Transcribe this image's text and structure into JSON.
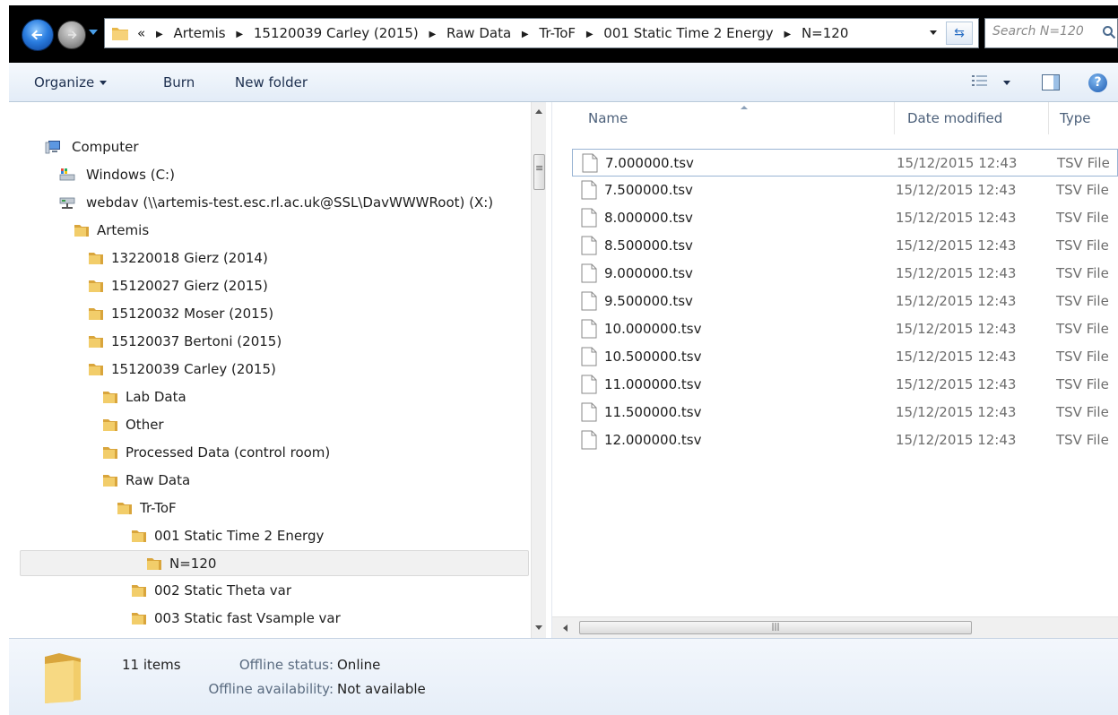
{
  "address_bar": {
    "overflow_marker": "«",
    "breadcrumbs": [
      "Artemis",
      "15120039 Carley (2015)",
      "Raw Data",
      "Tr-ToF",
      "001 Static Time 2 Energy",
      "N=120"
    ],
    "search_placeholder": "Search N=120"
  },
  "command_bar": {
    "organize_label": "Organize",
    "burn_label": "Burn",
    "new_folder_label": "New folder"
  },
  "navigation_tree": [
    {
      "label": "Computer",
      "icon": "computer-icon"
    },
    {
      "label": "Windows (C:)",
      "icon": "drive-icon"
    },
    {
      "label": "webdav (\\\\artemis-test.esc.rl.ac.uk@SSL\\DavWWWRoot) (X:)",
      "icon": "network-drive-icon"
    },
    {
      "label": "Artemis",
      "icon": "folder-icon"
    },
    {
      "label": "13220018 Gierz (2014)",
      "icon": "folder-icon"
    },
    {
      "label": "15120027 Gierz (2015)",
      "icon": "folder-icon"
    },
    {
      "label": "15120032 Moser (2015)",
      "icon": "folder-icon"
    },
    {
      "label": "15120037 Bertoni (2015)",
      "icon": "folder-icon"
    },
    {
      "label": "15120039 Carley (2015)",
      "icon": "folder-icon"
    },
    {
      "label": "Lab Data",
      "icon": "folder-icon"
    },
    {
      "label": "Other",
      "icon": "folder-icon"
    },
    {
      "label": "Processed Data (control room)",
      "icon": "folder-icon"
    },
    {
      "label": "Raw Data",
      "icon": "folder-icon"
    },
    {
      "label": "Tr-ToF",
      "icon": "folder-icon"
    },
    {
      "label": "001 Static Time 2 Energy",
      "icon": "folder-icon"
    },
    {
      "label": "N=120",
      "icon": "folder-icon",
      "selected": true
    },
    {
      "label": "002 Static Theta var",
      "icon": "folder-icon"
    },
    {
      "label": "003 Static fast Vsample var",
      "icon": "folder-icon"
    }
  ],
  "file_list": {
    "columns": {
      "name": "Name",
      "date_modified": "Date modified",
      "type": "Type"
    },
    "files": [
      {
        "name": "7.000000.tsv",
        "date": "15/12/2015 12:43",
        "type": "TSV File"
      },
      {
        "name": "7.500000.tsv",
        "date": "15/12/2015 12:43",
        "type": "TSV File"
      },
      {
        "name": "8.000000.tsv",
        "date": "15/12/2015 12:43",
        "type": "TSV File"
      },
      {
        "name": "8.500000.tsv",
        "date": "15/12/2015 12:43",
        "type": "TSV File"
      },
      {
        "name": "9.000000.tsv",
        "date": "15/12/2015 12:43",
        "type": "TSV File"
      },
      {
        "name": "9.500000.tsv",
        "date": "15/12/2015 12:43",
        "type": "TSV File"
      },
      {
        "name": "10.000000.tsv",
        "date": "15/12/2015 12:43",
        "type": "TSV File"
      },
      {
        "name": "10.500000.tsv",
        "date": "15/12/2015 12:43",
        "type": "TSV File"
      },
      {
        "name": "11.000000.tsv",
        "date": "15/12/2015 12:43",
        "type": "TSV File"
      },
      {
        "name": "11.500000.tsv",
        "date": "15/12/2015 12:43",
        "type": "TSV File"
      },
      {
        "name": "12.000000.tsv",
        "date": "15/12/2015 12:43",
        "type": "TSV File"
      }
    ]
  },
  "details_pane": {
    "items_count": "11 items",
    "offline_status_label": "Offline status:",
    "offline_status_value": "Online",
    "offline_availability_label": "Offline availability:",
    "offline_availability_value": "Not available"
  },
  "colors": {
    "address_bar_background": "#000000",
    "command_bar": "#e3ecf7",
    "folder": "#e8b84a",
    "selection": "#f1f1f1"
  }
}
